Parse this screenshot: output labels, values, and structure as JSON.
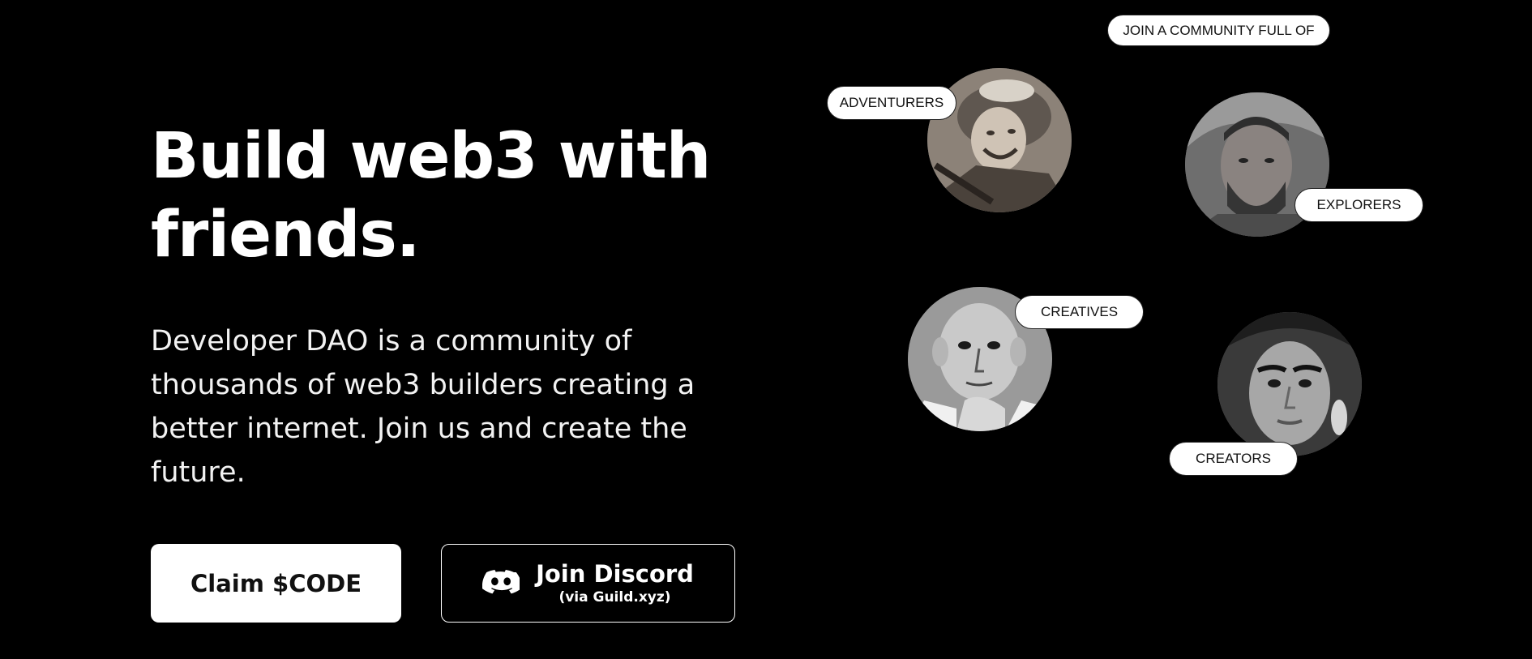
{
  "hero": {
    "headline": "Build web3 with friends.",
    "description": "Developer DAO is a community of thousands of web3 builders creating a better internet. Join us and create the future."
  },
  "actions": {
    "claim_label": "Claim $CODE",
    "discord_label": "Join Discord",
    "discord_sublabel": "(via Guild.xyz)",
    "discord_icon": "discord-icon"
  },
  "community": {
    "heading": "JOIN A COMMUNITY FULL OF",
    "tags": {
      "adventurers": "ADVENTURERS",
      "explorers": "EXPLORERS",
      "creatives": "CREATIVES",
      "creators": "CREATORS"
    }
  },
  "colors": {
    "background": "#000000",
    "text": "#ffffff",
    "pill_background": "#ffffff",
    "pill_text": "#111111"
  }
}
